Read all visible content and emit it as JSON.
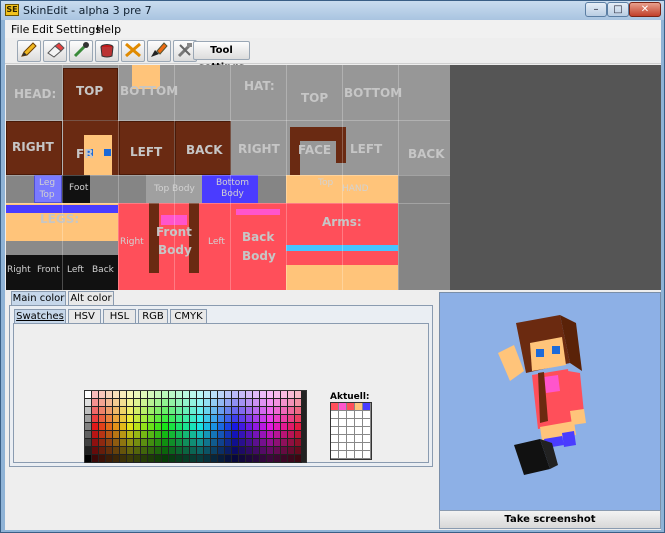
{
  "window": {
    "title": "SkinEdit - alpha 3 pre 7",
    "icon_text": "SE"
  },
  "menu": [
    "File",
    "Edit",
    "Settings",
    "Help"
  ],
  "toolbar": {
    "tools": [
      "pencil-icon",
      "eraser-icon",
      "eyedropper-icon",
      "bucket-icon",
      "swap-colors-icon",
      "brush-icon",
      "tools-icon"
    ],
    "settings_label": "Tool settings"
  },
  "canvas": {
    "head_label": "HEAD:",
    "hat_label": "HAT:",
    "head": {
      "top": "TOP",
      "bottom": "BOTTOM",
      "right": "RIGHT",
      "front": "FR",
      "left": "LEFT",
      "back": "BACK"
    },
    "hat": {
      "top": "TOP",
      "bottom": "BOTTOM",
      "right": "RIGHT",
      "face": "FACE",
      "left": "LEFT",
      "back": "BACK"
    },
    "legs": {
      "leg_top": "Leg\nTop",
      "foot": "Foot",
      "label": "LEGS:",
      "right": "Right",
      "front": "Front",
      "left": "Left",
      "back": "Back"
    },
    "body": {
      "top_body": "Top Body",
      "bottom_body": "Bottom\nBody",
      "right": "Right",
      "front": "Front",
      "body": "Body",
      "left": "Left",
      "back": "Back",
      "back_body": "Body"
    },
    "arms": {
      "top": "Top",
      "hand": "HAND",
      "label": "Arms:"
    }
  },
  "color_chooser": {
    "outer_tabs": [
      "Main color",
      "Alt color"
    ],
    "inner_tabs": [
      "Swatches",
      "HSV",
      "HSL",
      "RGB",
      "CMYK"
    ],
    "recent_label": "Aktuell:"
  },
  "preview": {
    "screenshot_label": "Take screenshot"
  },
  "colors": {
    "skin": "#ffc47a",
    "hair": "#6b2a10",
    "red": "#ff4f5a",
    "pink": "#ff55cc",
    "blue": "#4a3cff",
    "cyan": "#46c4ff",
    "black": "#111111",
    "preview_bg": "#8db0e6"
  }
}
